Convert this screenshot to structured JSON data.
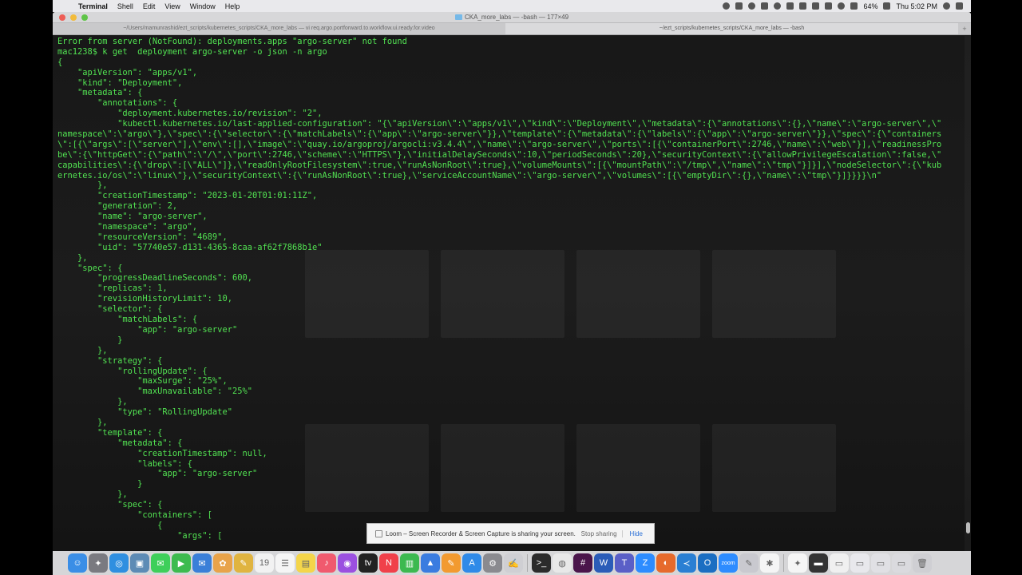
{
  "menubar": {
    "app_name": "Terminal",
    "items": [
      "Shell",
      "Edit",
      "View",
      "Window",
      "Help"
    ],
    "battery": "64%",
    "clock": "Thu 5:02 PM"
  },
  "window": {
    "title": "CKA_more_labs — -bash — 177×49",
    "tabs": [
      {
        "label": "~/Users/mamunrashid/ezt_scripts/kubernetes_scripts/CKA_more_labs — vi req.argo.portforward.to.workflow.ui.ready.for.video",
        "active": false
      },
      {
        "label": "~/ezt_scripts/kubernetes_scripts/CKA_more_labs — -bash",
        "active": true
      }
    ]
  },
  "terminal": {
    "lines": [
      "Error from server (NotFound): deployments.apps \"argo-server\" not found",
      "mac1238$ k get  deployment argo-server -o json -n argo",
      "{",
      "    \"apiVersion\": \"apps/v1\",",
      "    \"kind\": \"Deployment\",",
      "    \"metadata\": {",
      "        \"annotations\": {",
      "            \"deployment.kubernetes.io/revision\": \"2\",",
      "            \"kubectl.kubernetes.io/last-applied-configuration\": \"{\\\"apiVersion\\\":\\\"apps/v1\\\",\\\"kind\\\":\\\"Deployment\\\",\\\"metadata\\\":{\\\"annotations\\\":{},\\\"name\\\":\\\"argo-server\\\",\\\"",
      "namespace\\\":\\\"argo\\\"},\\\"spec\\\":{\\\"selector\\\":{\\\"matchLabels\\\":{\\\"app\\\":\\\"argo-server\\\"}},\\\"template\\\":{\\\"metadata\\\":{\\\"labels\\\":{\\\"app\\\":\\\"argo-server\\\"}},\\\"spec\\\":{\\\"containers",
      "\\\":[{\\\"args\\\":[\\\"server\\\"],\\\"env\\\":[],\\\"image\\\":\\\"quay.io/argoproj/argocli:v3.4.4\\\",\\\"name\\\":\\\"argo-server\\\",\\\"ports\\\":[{\\\"containerPort\\\":2746,\\\"name\\\":\\\"web\\\"}],\\\"readinessPro",
      "be\\\":{\\\"httpGet\\\":{\\\"path\\\":\\\"/\\\",\\\"port\\\":2746,\\\"scheme\\\":\\\"HTTPS\\\"},\\\"initialDelaySeconds\\\":10,\\\"periodSeconds\\\":20},\\\"securityContext\\\":{\\\"allowPrivilegeEscalation\\\":false,\\\"",
      "capabilities\\\":{\\\"drop\\\":[\\\"ALL\\\"]},\\\"readOnlyRootFilesystem\\\":true,\\\"runAsNonRoot\\\":true},\\\"volumeMounts\\\":[{\\\"mountPath\\\":\\\"/tmp\\\",\\\"name\\\":\\\"tmp\\\"}]}],\\\"nodeSelector\\\":{\\\"kub",
      "ernetes.io/os\\\":\\\"linux\\\"},\\\"securityContext\\\":{\\\"runAsNonRoot\\\":true},\\\"serviceAccountName\\\":\\\"argo-server\\\",\\\"volumes\\\":[{\\\"emptyDir\\\":{},\\\"name\\\":\\\"tmp\\\"}]}}}}\\n\"",
      "        },",
      "        \"creationTimestamp\": \"2023-01-20T01:01:11Z\",",
      "        \"generation\": 2,",
      "        \"name\": \"argo-server\",",
      "        \"namespace\": \"argo\",",
      "        \"resourceVersion\": \"4689\",",
      "        \"uid\": \"57740e57-d131-4365-8caa-af62f7868b1e\"",
      "    },",
      "    \"spec\": {",
      "        \"progressDeadlineSeconds\": 600,",
      "        \"replicas\": 1,",
      "        \"revisionHistoryLimit\": 10,",
      "        \"selector\": {",
      "            \"matchLabels\": {",
      "                \"app\": \"argo-server\"",
      "            }",
      "        },",
      "        \"strategy\": {",
      "            \"rollingUpdate\": {",
      "                \"maxSurge\": \"25%\",",
      "                \"maxUnavailable\": \"25%\"",
      "            },",
      "            \"type\": \"RollingUpdate\"",
      "        },",
      "        \"template\": {",
      "            \"metadata\": {",
      "                \"creationTimestamp\": null,",
      "                \"labels\": {",
      "                    \"app\": \"argo-server\"",
      "                }",
      "            },",
      "            \"spec\": {",
      "                \"containers\": [",
      "                    {",
      "                        \"args\": ["
    ]
  },
  "loom": {
    "message": "Loom – Screen Recorder & Screen Capture is sharing your screen.",
    "stop_label": "Stop sharing",
    "hide_label": "Hide"
  },
  "dock": {
    "icons": [
      {
        "name": "finder-icon",
        "color": "#3a8ee6",
        "glyph": "☺"
      },
      {
        "name": "launchpad-icon",
        "color": "#7a7a80",
        "glyph": "✦"
      },
      {
        "name": "safari-icon",
        "color": "#2f8fe0",
        "glyph": "◎"
      },
      {
        "name": "preview-icon",
        "color": "#5d8bb5",
        "glyph": "▣"
      },
      {
        "name": "messages-icon",
        "color": "#3ecf5a",
        "glyph": "✉"
      },
      {
        "name": "facetime-icon",
        "color": "#3dbb4f",
        "glyph": "▶"
      },
      {
        "name": "mail-icon",
        "color": "#3a7fd8",
        "glyph": "✉"
      },
      {
        "name": "photos-icon",
        "color": "#e8a34a",
        "glyph": "✿"
      },
      {
        "name": "notes-icon",
        "color": "#e0b440",
        "glyph": "✎"
      },
      {
        "name": "calendar-icon",
        "color": "#f2f2f2",
        "glyph": "19"
      },
      {
        "name": "reminders-icon",
        "color": "#f5f5f5",
        "glyph": "☰"
      },
      {
        "name": "stickies-icon",
        "color": "#f4d54a",
        "glyph": "▤"
      },
      {
        "name": "music-icon",
        "color": "#f05a6e",
        "glyph": "♪"
      },
      {
        "name": "podcasts-icon",
        "color": "#9b50e0",
        "glyph": "◉"
      },
      {
        "name": "tv-icon",
        "color": "#222",
        "glyph": "tv"
      },
      {
        "name": "news-icon",
        "color": "#f0404a",
        "glyph": "N"
      },
      {
        "name": "numbers-icon",
        "color": "#3cb950",
        "glyph": "▥"
      },
      {
        "name": "keynote-icon",
        "color": "#3a7ce0",
        "glyph": "▲"
      },
      {
        "name": "pages-icon",
        "color": "#f29a30",
        "glyph": "✎"
      },
      {
        "name": "app-store-icon",
        "color": "#2f8ae8",
        "glyph": "A"
      },
      {
        "name": "system-preferences-icon",
        "color": "#8a8a8f",
        "glyph": "⚙"
      },
      {
        "name": "script-editor-icon",
        "color": "#cfcfd3",
        "glyph": "✍"
      },
      {
        "name": "terminal-icon",
        "color": "#2b2b2b",
        "glyph": ">_"
      },
      {
        "name": "chrome-icon",
        "color": "#e8e8e8",
        "glyph": "◍"
      },
      {
        "name": "slack-icon",
        "color": "#4a154b",
        "glyph": "#"
      },
      {
        "name": "word-icon",
        "color": "#2b5cb8",
        "glyph": "W"
      },
      {
        "name": "teams-icon",
        "color": "#5a5fc7",
        "glyph": "T"
      },
      {
        "name": "zoom-icon",
        "color": "#2d8cff",
        "glyph": "Z"
      },
      {
        "name": "firefox-icon",
        "color": "#e66a2c",
        "glyph": "◐"
      },
      {
        "name": "vscode-icon",
        "color": "#2a7fd3",
        "glyph": "≺"
      },
      {
        "name": "outlook-icon",
        "color": "#1b6ec2",
        "glyph": "O"
      },
      {
        "name": "zoom-meeting-icon",
        "color": "#2d8cff",
        "glyph": "zoom"
      },
      {
        "name": "notepad-icon",
        "color": "#c9c9cf",
        "glyph": "✎"
      },
      {
        "name": "loom-icon",
        "color": "#f5f5f5",
        "glyph": "✱"
      },
      {
        "name": "github-icon",
        "color": "#f5f5f5",
        "glyph": "✦"
      },
      {
        "name": "stacks-terminal-icon",
        "color": "#333",
        "glyph": "▬"
      },
      {
        "name": "document-icon",
        "color": "#f0f0f0",
        "glyph": "▭"
      },
      {
        "name": "preview-doc-icon",
        "color": "#e8e8ec",
        "glyph": "▭"
      },
      {
        "name": "folder-stack-icon",
        "color": "#e0e0e4",
        "glyph": "▭"
      },
      {
        "name": "downloads-icon",
        "color": "#dadade",
        "glyph": "▭"
      },
      {
        "name": "trash-icon",
        "color": "#cfcfd3",
        "glyph": "🗑"
      }
    ]
  }
}
